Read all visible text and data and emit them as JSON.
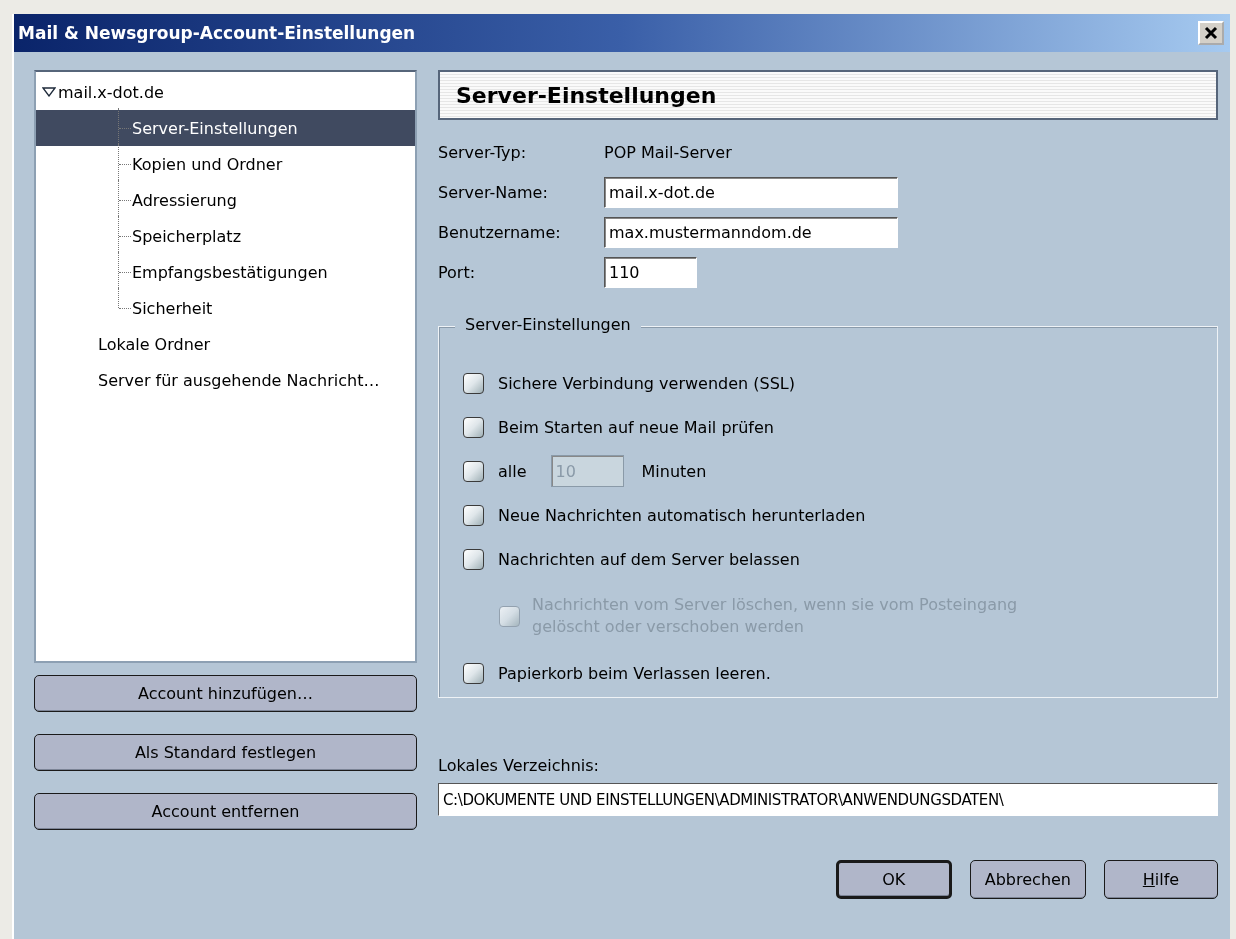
{
  "window": {
    "title": "Mail & Newsgroup-Account-Einstellungen"
  },
  "tree": [
    {
      "label": "mail.x-dot.de",
      "expanded": true,
      "selected": false,
      "children": [
        {
          "label": "Server-Einstellungen",
          "selected": true
        },
        {
          "label": "Kopien und Ordner",
          "selected": false
        },
        {
          "label": "Adressierung",
          "selected": false
        },
        {
          "label": "Speicherplatz",
          "selected": false
        },
        {
          "label": "Empfangsbestätigungen",
          "selected": false
        },
        {
          "label": "Sicherheit",
          "selected": false
        }
      ]
    },
    {
      "label": "Lokale Ordner",
      "selected": false
    },
    {
      "label": "Server für ausgehende Nachricht…",
      "selected": false
    }
  ],
  "account_buttons": [
    "Account hinzufügen…",
    "Als Standard festlegen",
    "Account entfernen"
  ],
  "panel_title": "Server-Einstellungen",
  "server_type": {
    "label": "Server-Typ:",
    "value": "POP Mail-Server"
  },
  "fields": [
    {
      "label": "Server-Name:",
      "value": "mail.x-dot.de",
      "kind": "wide"
    },
    {
      "label": "Benutzername:",
      "value": "max.mustermanndom.de",
      "kind": "wide"
    },
    {
      "label": "Port:",
      "value": "110",
      "kind": "short"
    }
  ],
  "group": {
    "legend": "Server-Einstellungen",
    "options": [
      {
        "kind": "checkbox",
        "label": "Sichere Verbindung verwenden (SSL)",
        "checked": false,
        "disabled": false
      },
      {
        "kind": "checkbox",
        "label": "Beim Starten auf neue Mail prüfen",
        "checked": false,
        "disabled": false
      },
      {
        "kind": "interval",
        "label": "alle",
        "value": "10",
        "unit": "Minuten",
        "checked": false,
        "disabled": false,
        "field_disabled": true
      },
      {
        "kind": "checkbox",
        "label": "Neue Nachrichten automatisch herunterladen",
        "checked": false,
        "disabled": false
      },
      {
        "kind": "checkbox",
        "label": "Nachrichten auf dem Server belassen",
        "checked": false,
        "disabled": false,
        "children": [
          {
            "label": "Nachrichten vom Server löschen, wenn sie vom Posteingang gelöscht oder verschoben werden",
            "checked": false,
            "disabled": true
          }
        ]
      },
      {
        "kind": "checkbox",
        "label": "Papierkorb beim Verlassen leeren.",
        "checked": false,
        "disabled": false
      }
    ]
  },
  "local_directory": {
    "label": "Lokales Verzeichnis:",
    "value": "C:\\DOKUMENTE UND EINSTELLUNGEN\\ADMINISTRATOR\\ANWENDUNGSDATEN\\"
  },
  "dialog_buttons": [
    {
      "label": "OK",
      "default": true,
      "access_key_underlined": false
    },
    {
      "label": "Abbrechen",
      "default": false,
      "access_key_underlined": false
    },
    {
      "label": "Hilfe",
      "default": false,
      "access_key_underlined": true
    }
  ]
}
